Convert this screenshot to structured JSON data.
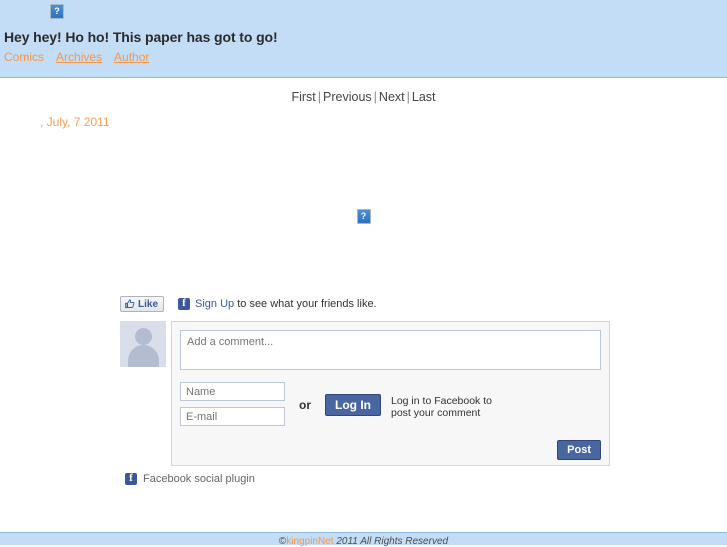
{
  "header": {
    "logo_icon": "broken-image-icon",
    "site_title": "Hey hey! Ho ho! This paper has got to go!",
    "nav": [
      {
        "label": "Comics",
        "is_link": false
      },
      {
        "label": "Archives",
        "is_link": true
      },
      {
        "label": "Author",
        "is_link": true
      }
    ]
  },
  "comic_nav": {
    "first": "First",
    "previous": "Previous",
    "next": "Next",
    "last": "Last",
    "separator": "|"
  },
  "comic": {
    "date": ", July, 7 2011",
    "image_icon": "broken-image-icon"
  },
  "facebook": {
    "like_label": "Like",
    "signup_link": "Sign Up",
    "signup_suffix": " to see what your friends like.",
    "comment_placeholder": "Add a comment...",
    "name_placeholder": "Name",
    "email_placeholder": "E-mail",
    "or_label": "or",
    "login_label": "Log In",
    "login_note_line1": "Log in to Facebook to",
    "login_note_line2": "post your comment",
    "post_label": "Post",
    "plugin_label": "Facebook social plugin",
    "fb_icon": "facebook-f-icon",
    "thumb_icon": "thumbs-up-icon",
    "avatar_icon": "default-avatar-icon"
  },
  "footer": {
    "copyright_symbol": "©",
    "site_link": "kingpinNet",
    "year_rights": " 2011  All Rights Reserved"
  },
  "colors": {
    "header_band": "#c3ddf7",
    "accent_orange": "#f79646",
    "fb_blue": "#3b5998",
    "fb_button": "#4a66a0"
  }
}
